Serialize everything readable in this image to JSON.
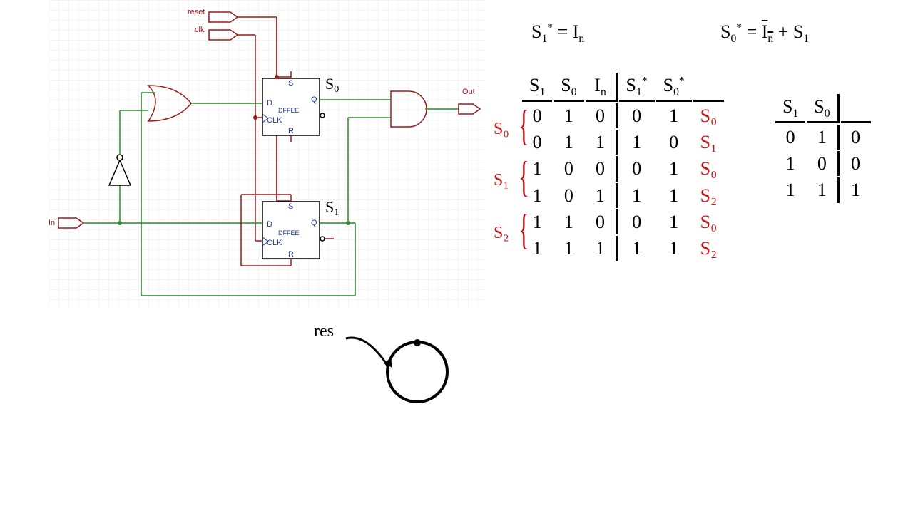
{
  "equations": {
    "s1_star": "S₁* = Iₙ",
    "s0_star": "S₀* = ‾Iₙ + S₁"
  },
  "circuit": {
    "inputs": {
      "reset": "reset",
      "clk": "clk",
      "in": "In"
    },
    "output": "Out",
    "ff_type": "DFFEE",
    "ff_pins": {
      "d": "D",
      "q": "Q",
      "clk": "CLK",
      "s": "S",
      "r": "R"
    },
    "outputs_labels": {
      "s0": "S₀",
      "s1": "S₁"
    }
  },
  "state_table": {
    "headers": [
      "S₁",
      "S₀",
      "Iₙ",
      "S₁*",
      "S₀*"
    ],
    "groups": [
      {
        "label": "S₀",
        "rows": [
          {
            "s1": "0",
            "s0": "1",
            "in": "0",
            "s1s": "0",
            "s0s": "1",
            "next": "S₀"
          },
          {
            "s1": "0",
            "s0": "1",
            "in": "1",
            "s1s": "1",
            "s0s": "0",
            "next": "S₁"
          }
        ]
      },
      {
        "label": "S₁",
        "rows": [
          {
            "s1": "1",
            "s0": "0",
            "in": "0",
            "s1s": "0",
            "s0s": "1",
            "next": "S₀"
          },
          {
            "s1": "1",
            "s0": "0",
            "in": "1",
            "s1s": "1",
            "s0s": "1",
            "next": "S₂"
          }
        ]
      },
      {
        "label": "S₂",
        "rows": [
          {
            "s1": "1",
            "s0": "1",
            "in": "0",
            "s1s": "0",
            "s0s": "1",
            "next": "S₀"
          },
          {
            "s1": "1",
            "s0": "1",
            "in": "1",
            "s1s": "1",
            "s0s": "1",
            "next": "S₂"
          }
        ]
      }
    ]
  },
  "output_table": {
    "headers": [
      "S₁",
      "S₀",
      ""
    ],
    "rows": [
      {
        "s1": "0",
        "s0": "1",
        "out": "0"
      },
      {
        "s1": "1",
        "s0": "0",
        "out": "0"
      },
      {
        "s1": "1",
        "s0": "1",
        "out": "1"
      }
    ]
  },
  "sketch": {
    "label": "res"
  }
}
